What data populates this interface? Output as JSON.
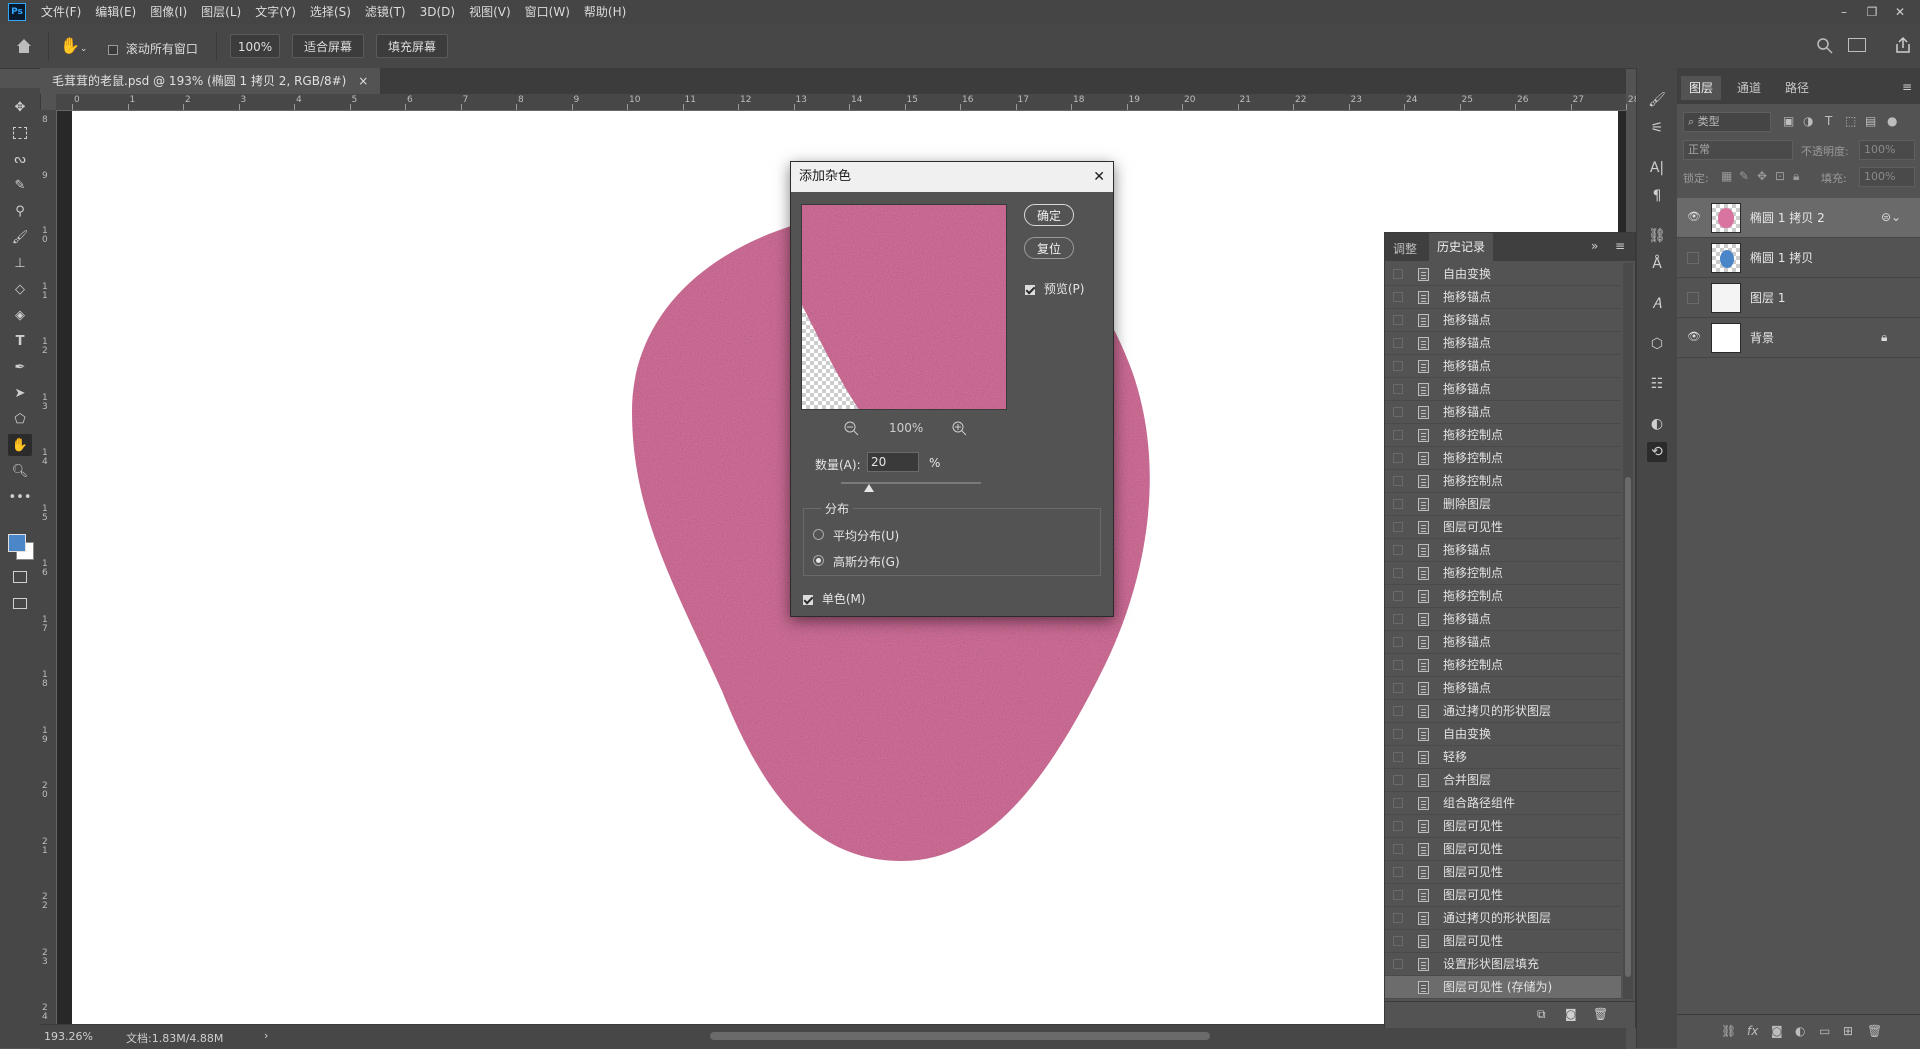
{
  "app": {
    "logo": "Ps"
  },
  "menu": [
    "文件(F)",
    "编辑(E)",
    "图像(I)",
    "图层(L)",
    "文字(Y)",
    "选择(S)",
    "滤镜(T)",
    "3D(D)",
    "视图(V)",
    "窗口(W)",
    "帮助(H)"
  ],
  "window_controls": {
    "minimize": "–",
    "restore": "❐",
    "close": "✕"
  },
  "options_bar": {
    "scroll_all_label": "滚动所有窗口",
    "zoom_value": "100%",
    "fit_screen": "适合屏幕",
    "fill_screen": "填充屏幕"
  },
  "document": {
    "tab_title": "毛茸茸的老鼠.psd @ 193% (椭圆 1 拷贝 2, RGB/8#)",
    "tab_close": "×"
  },
  "ruler": {
    "top_ticks": [
      "0",
      "1",
      "2",
      "3",
      "4",
      "5",
      "6",
      "7",
      "8",
      "9",
      "10",
      "11",
      "12",
      "13",
      "14",
      "15",
      "16",
      "17",
      "18",
      "19",
      "20",
      "21",
      "22",
      "23",
      "24",
      "25",
      "26",
      "27",
      "28"
    ],
    "left_ticks": [
      "8",
      "9",
      "10",
      "11",
      "12",
      "13",
      "14",
      "15",
      "16",
      "17",
      "18",
      "19",
      "20",
      "21",
      "22",
      "23",
      "24"
    ]
  },
  "status": {
    "zoom": "193.26%",
    "doc": "文档:1.83M/4.88M",
    "arrow": "›"
  },
  "dialog": {
    "title": "添加杂色",
    "close": "✕",
    "ok": "确定",
    "reset": "复位",
    "preview_label": "预览(P)",
    "preview_checked": true,
    "zoom_value": "100%",
    "amount_label": "数量(A):",
    "amount_value": "20",
    "amount_unit": "%",
    "amount_fraction": 0.2,
    "distribution_label": "分布",
    "uniform_label": "平均分布(U)",
    "gaussian_label": "高斯分布(G)",
    "selected_distribution": "gaussian",
    "mono_label": "单色(M)",
    "mono_checked": true
  },
  "history": {
    "tabs": [
      "调整",
      "历史记录"
    ],
    "active_tab": "历史记录",
    "items": [
      "自由变换",
      "拖移锚点",
      "拖移锚点",
      "拖移锚点",
      "拖移锚点",
      "拖移锚点",
      "拖移锚点",
      "拖移控制点",
      "拖移控制点",
      "拖移控制点",
      "删除图层",
      "图层可见性",
      "拖移锚点",
      "拖移控制点",
      "拖移控制点",
      "拖移锚点",
      "拖移锚点",
      "拖移控制点",
      "拖移锚点",
      "通过拷贝的形状图层",
      "自由变换",
      "轻移",
      "合并图层",
      "组合路径组件",
      "图层可见性",
      "图层可见性",
      "图层可见性",
      "图层可见性",
      "通过拷贝的形状图层",
      "图层可见性",
      "设置形状图层填充",
      "图层可见性 (存储为)"
    ],
    "selected_index": 31
  },
  "layers": {
    "tabs": [
      "图层",
      "通道",
      "路径"
    ],
    "active_tab": "图层",
    "filter_placeholder": "类型",
    "blend_mode": "正常",
    "opacity_label": "不透明度:",
    "opacity_value": "100%",
    "lock_label": "锁定:",
    "fill_label": "填充:",
    "fill_value": "100%",
    "items": [
      {
        "name": "椭圆 1 拷贝 2",
        "visible": true,
        "selected": true
      },
      {
        "name": "椭圆 1 拷贝",
        "visible": false,
        "selected": false
      },
      {
        "name": "图层 1",
        "visible": false,
        "selected": false
      },
      {
        "name": "背景",
        "visible": true,
        "selected": false,
        "locked": true
      }
    ]
  },
  "colors": {
    "accent": "#31a8ff",
    "shape": "#d9739f",
    "foreground": "#4a86c8",
    "background": "#ffffff"
  },
  "icons": [
    "move-icon",
    "marquee-icon",
    "lasso-icon",
    "quick-select-icon",
    "eyedropper-icon",
    "brush-icon",
    "stamp-icon",
    "eraser-icon",
    "bucket-icon",
    "type-icon",
    "pen-icon",
    "path-select-icon",
    "shape-icon",
    "hand-icon",
    "zoom-icon",
    "more-icon"
  ]
}
